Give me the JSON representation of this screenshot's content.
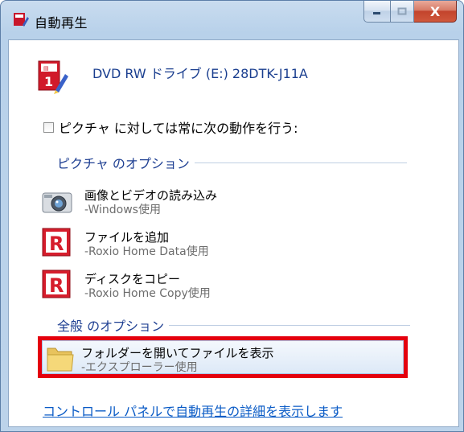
{
  "window": {
    "title": "自動再生",
    "caption_buttons": [
      "minimize",
      "maximize",
      "close"
    ],
    "close_glyph": "X"
  },
  "device": {
    "name": "DVD RW ドライブ (E:) 28DTK-J11A",
    "icon": "media-player-icon"
  },
  "always_do": {
    "checked": false,
    "label": "ピクチャ に対しては常に次の動作を行う:"
  },
  "sections": {
    "pictures": {
      "title": "ピクチャ のオプション",
      "options": [
        {
          "title": "画像とビデオの読み込み",
          "subtitle": "-Windows使用",
          "icon": "camera-icon"
        },
        {
          "title": "ファイルを追加",
          "subtitle": "-Roxio Home Data使用",
          "icon": "roxio-icon"
        },
        {
          "title": "ディスクをコピー",
          "subtitle": "-Roxio Home Copy使用",
          "icon": "roxio-icon"
        }
      ]
    },
    "general": {
      "title": "全般 のオプション",
      "options": [
        {
          "title": "フォルダーを開いてファイルを表示",
          "subtitle": "-エクスプローラー使用",
          "icon": "folder-icon",
          "highlighted": true
        }
      ]
    }
  },
  "control_panel_link": "コントロール パネルで自動再生の詳細を表示します",
  "colors": {
    "highlight_border": "#e4000e",
    "link": "#0a5bc6",
    "section_title": "#1e3f92"
  }
}
